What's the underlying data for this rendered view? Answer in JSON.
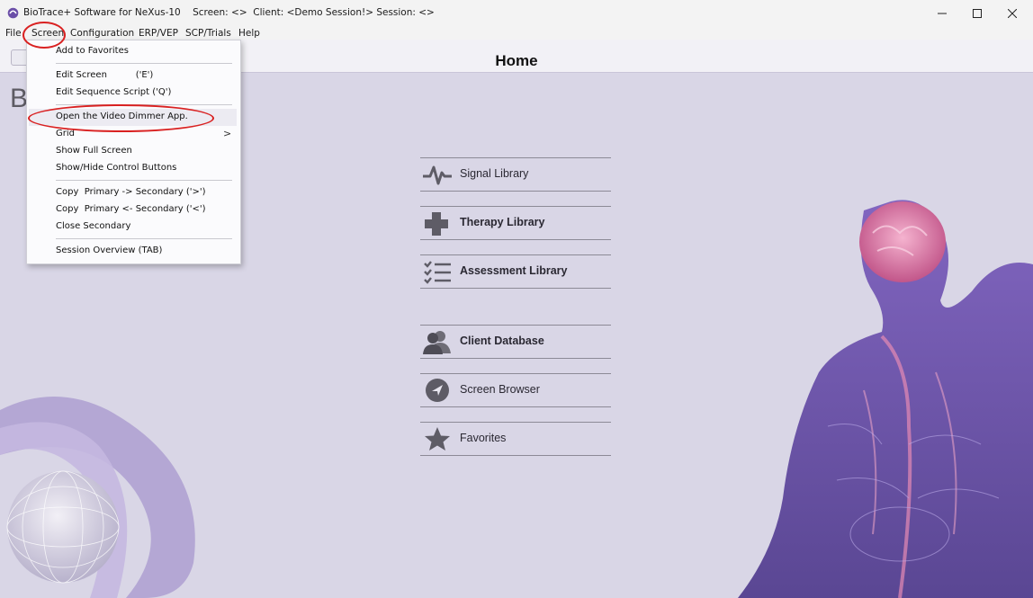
{
  "window": {
    "title": "BioTrace+ Software for NeXus-10    Screen: <>  Client: <Demo Session!> Session: <>",
    "controls": [
      "minimize",
      "maximize",
      "close"
    ]
  },
  "menubar": {
    "items": [
      {
        "id": "file",
        "label": "File"
      },
      {
        "id": "screen",
        "label": "Screen"
      },
      {
        "id": "configuration",
        "label": "Configuration"
      },
      {
        "id": "erp-vep",
        "label": "ERP/VEP"
      },
      {
        "id": "scp-trials",
        "label": "SCP/Trials"
      },
      {
        "id": "help",
        "label": "Help"
      }
    ]
  },
  "screen_menu": {
    "items": [
      {
        "label": "Add to Favorites"
      },
      {
        "label": "Edit Screen          ('E')"
      },
      {
        "label": "Edit Sequence Script ('Q')"
      },
      {
        "label": "Open the Video Dimmer App."
      },
      {
        "label": "Grid"
      },
      {
        "label": "Show Full Screen"
      },
      {
        "label": "Show/Hide Control Buttons"
      },
      {
        "label": "Copy  Primary -> Secondary ('>')"
      },
      {
        "label": "Copy  Primary <- Secondary ('<')"
      },
      {
        "label": "Close Secondary"
      },
      {
        "label": "Session Overview (TAB)"
      }
    ],
    "submenu_arrow": ">"
  },
  "main": {
    "title": "Home",
    "partial_heading": "B",
    "libraries": [
      {
        "label": "Signal Library",
        "icon": "pulse-icon"
      },
      {
        "label": "Therapy Library",
        "icon": "plus-icon"
      },
      {
        "label": "Assessment Library",
        "icon": "checklist-icon"
      },
      {
        "label": "Client Database",
        "icon": "users-icon"
      },
      {
        "label": "Screen Browser",
        "icon": "compass-icon"
      },
      {
        "label": "Favorites",
        "icon": "star-icon"
      }
    ]
  },
  "colors": {
    "background": "#d9d6e6",
    "icon_gray": "#5e5c66",
    "highlight_red": "#d92121",
    "figure_purple": "#6a4aa8",
    "brain_pink": "#e07aa8"
  }
}
